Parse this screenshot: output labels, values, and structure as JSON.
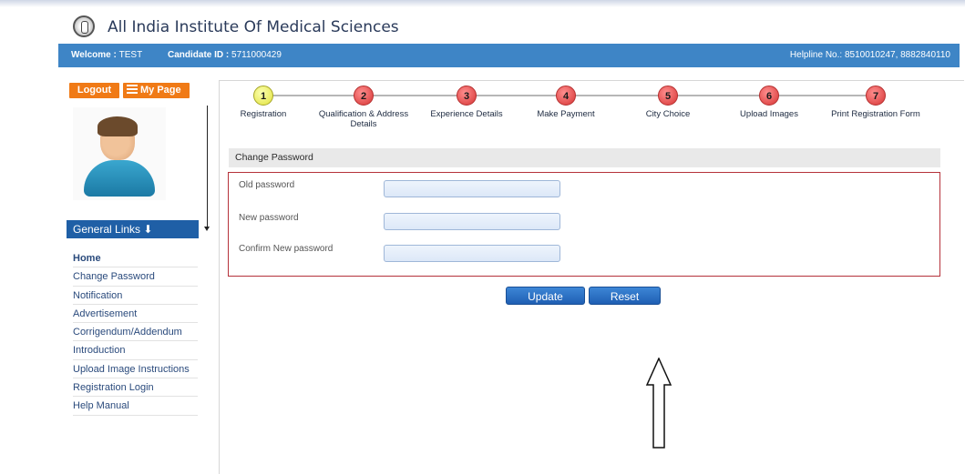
{
  "header": {
    "title": "All India Institute Of Medical Sciences"
  },
  "bluebar": {
    "welcome_label": "Welcome :",
    "welcome_name": "TEST",
    "candidate_label": "Candidate ID :",
    "candidate_id": "5711000429",
    "helpline": "Helpline No.: 8510010247, 8882840110"
  },
  "sidebar": {
    "logout_label": "Logout",
    "mypage_label": "My Page",
    "general_links_label": "General Links ⬇",
    "links": [
      "Home",
      "Change Password",
      "Notification",
      "Advertisement",
      "Corrigendum/Addendum",
      "Introduction",
      "Upload Image Instructions",
      "Registration Login",
      "Help Manual"
    ]
  },
  "steps": [
    {
      "num": "1",
      "label": "Registration"
    },
    {
      "num": "2",
      "label": "Qualification & Address Details"
    },
    {
      "num": "3",
      "label": "Experience Details"
    },
    {
      "num": "4",
      "label": "Make Payment"
    },
    {
      "num": "5",
      "label": "City Choice"
    },
    {
      "num": "6",
      "label": "Upload Images"
    },
    {
      "num": "7",
      "label": "Print Registration Form"
    }
  ],
  "change_password": {
    "header": "Change Password",
    "old_label": "Old password",
    "new_label": "New password",
    "confirm_label": "Confirm New password",
    "old_value": "",
    "new_value": "",
    "confirm_value": "",
    "update_label": "Update",
    "reset_label": "Reset"
  },
  "icons": {
    "logo": "aiims-emblem-icon",
    "mypage": "list-icon",
    "avatar": "user-avatar-icon",
    "annotation": "up-arrow-icon"
  },
  "colors": {
    "bluebar": "#3e85c6",
    "orange_button": "#f07a16",
    "step_pending": "#d63434",
    "step_active": "#e2e23c",
    "box_border": "#b5323a"
  }
}
